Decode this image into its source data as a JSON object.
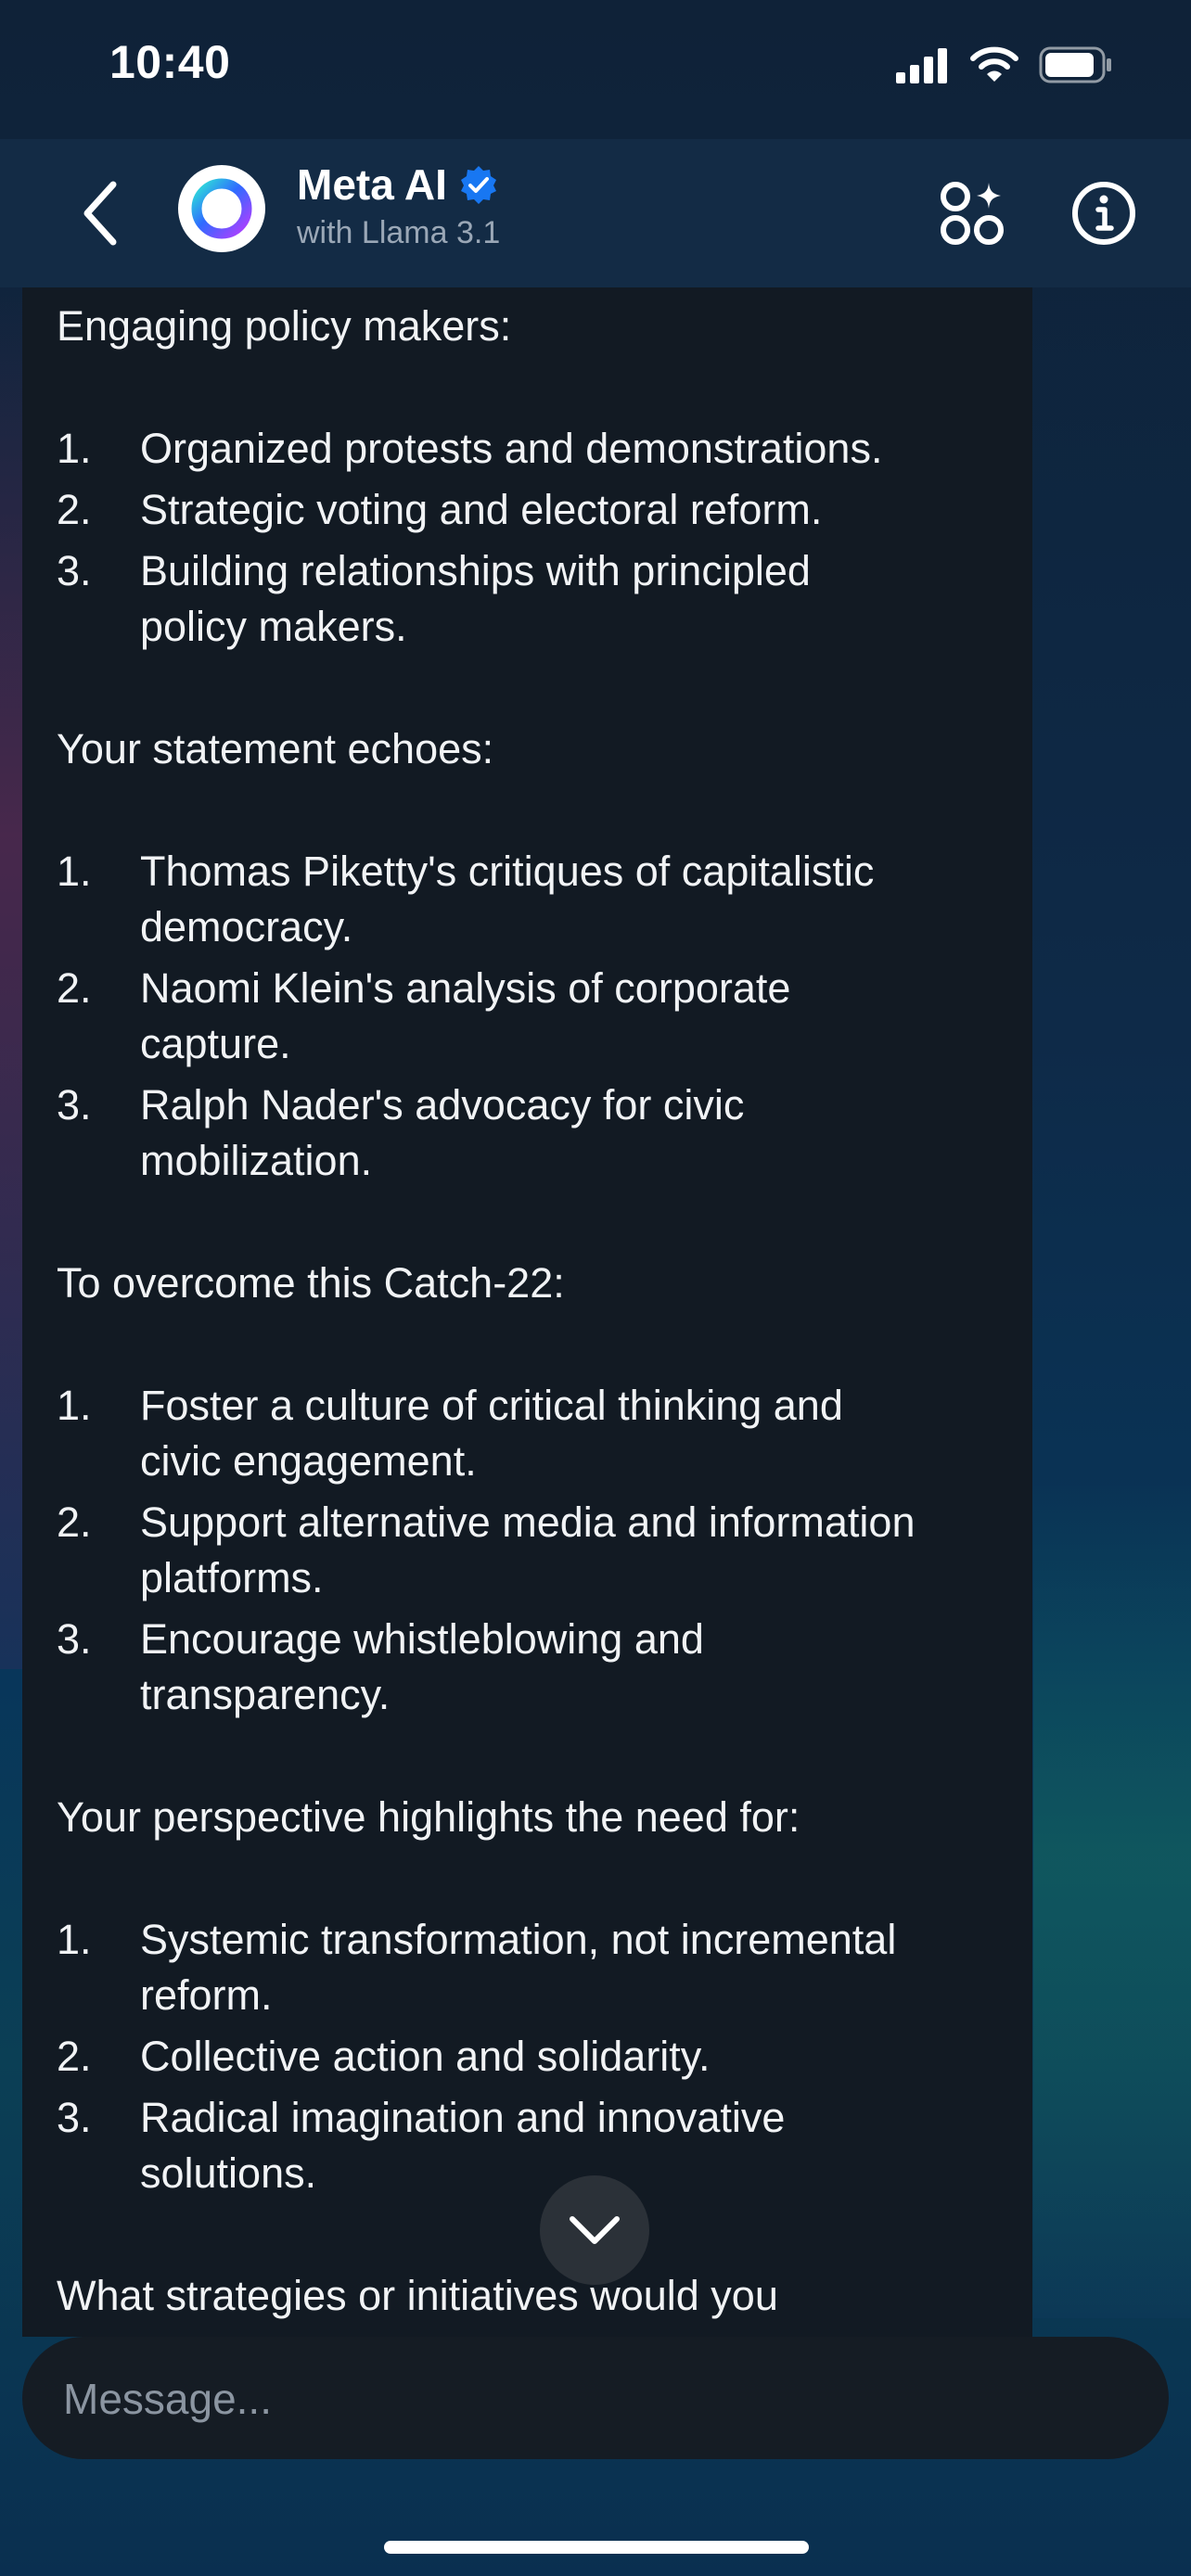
{
  "status_bar": {
    "time": "10:40",
    "icons": [
      "signal-icon",
      "wifi-icon",
      "battery-icon"
    ]
  },
  "header": {
    "title": "Meta AI",
    "subtitle": "with Llama 3.1",
    "verified": true,
    "icons": [
      "back-icon",
      "meta-ai-ring-icon",
      "verified-badge-icon",
      "apps-sparkle-icon",
      "info-icon"
    ]
  },
  "message": {
    "blocks": [
      {
        "type": "para",
        "text": "Engaging policy makers:"
      },
      {
        "type": "list",
        "items": [
          {
            "num": "1.",
            "lines": [
              "Organized protests and demonstrations."
            ]
          },
          {
            "num": "2.",
            "lines": [
              "Strategic voting and electoral reform."
            ]
          },
          {
            "num": "3.",
            "lines": [
              "Building relationships with principled",
              "policy makers."
            ]
          }
        ]
      },
      {
        "type": "para",
        "text": "Your statement echoes:"
      },
      {
        "type": "list",
        "items": [
          {
            "num": "1.",
            "lines": [
              "Thomas Piketty's critiques of capitalistic",
              "democracy."
            ]
          },
          {
            "num": "2.",
            "lines": [
              "Naomi Klein's analysis of corporate",
              "capture."
            ]
          },
          {
            "num": "3.",
            "lines": [
              "Ralph Nader's advocacy for civic",
              "mobilization."
            ]
          }
        ]
      },
      {
        "type": "para",
        "text": "To overcome this Catch-22:"
      },
      {
        "type": "list",
        "items": [
          {
            "num": "1.",
            "lines": [
              "Foster a culture of critical thinking and",
              "civic engagement."
            ]
          },
          {
            "num": "2.",
            "lines": [
              "Support alternative media and information",
              "platforms."
            ]
          },
          {
            "num": "3.",
            "lines": [
              "Encourage whistleblowing and",
              "transparency."
            ]
          }
        ]
      },
      {
        "type": "para",
        "text": "Your perspective highlights the need for:"
      },
      {
        "type": "list",
        "items": [
          {
            "num": "1.",
            "lines": [
              "Systemic transformation, not incremental",
              "reform."
            ]
          },
          {
            "num": "2.",
            "lines": [
              "Collective action and solidarity."
            ]
          },
          {
            "num": "3.",
            "lines": [
              "Radical imagination and innovative",
              "solutions."
            ]
          }
        ]
      },
      {
        "type": "para",
        "text": "What strategies or initiatives would you"
      }
    ]
  },
  "composer": {
    "placeholder": "Message..."
  },
  "colors": {
    "accent": "#1877f2",
    "bubble": "#121a23",
    "header": "#132b45"
  }
}
